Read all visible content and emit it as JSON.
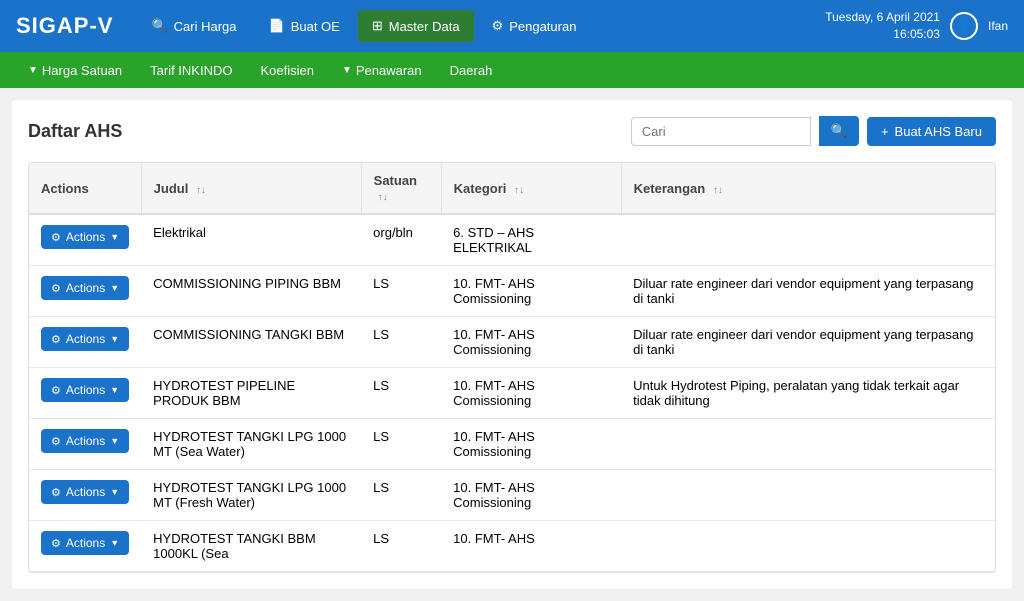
{
  "app": {
    "logo": "SIGAP-V",
    "datetime": "Tuesday, 6 April 2021",
    "time": "16:05:03",
    "user": "Ifan"
  },
  "topnav": {
    "items": [
      {
        "id": "cari-harga",
        "label": "Cari Harga",
        "icon": "🔍",
        "active": false
      },
      {
        "id": "buat-oe",
        "label": "Buat OE",
        "icon": "📄",
        "active": false
      },
      {
        "id": "master-data",
        "label": "Master Data",
        "icon": "⊞",
        "active": true
      },
      {
        "id": "pengaturan",
        "label": "Pengaturan",
        "icon": "⚙",
        "active": false
      }
    ]
  },
  "subnav": {
    "items": [
      {
        "id": "harga-satuan",
        "label": "Harga Satuan",
        "has_dropdown": true
      },
      {
        "id": "tarif-inkindo",
        "label": "Tarif INKINDO",
        "has_dropdown": false
      },
      {
        "id": "koefisien",
        "label": "Koefisien",
        "has_dropdown": false
      },
      {
        "id": "penawaran",
        "label": "Penawaran",
        "has_dropdown": true
      },
      {
        "id": "daerah",
        "label": "Daerah",
        "has_dropdown": false
      }
    ]
  },
  "page": {
    "title": "Daftar AHS",
    "search_placeholder": "Cari",
    "create_button": "Buat AHS Baru"
  },
  "table": {
    "columns": [
      {
        "id": "actions",
        "label": "Actions",
        "sortable": false
      },
      {
        "id": "judul",
        "label": "Judul",
        "sortable": true
      },
      {
        "id": "satuan",
        "label": "Satuan",
        "sortable": true
      },
      {
        "id": "kategori",
        "label": "Kategori",
        "sortable": true
      },
      {
        "id": "keterangan",
        "label": "Keterangan",
        "sortable": true
      }
    ],
    "rows": [
      {
        "id": 1,
        "judul": "Elektrikal",
        "satuan": "org/bln",
        "kategori": "6. STD – AHS ELEKTRIKAL",
        "keterangan": ""
      },
      {
        "id": 2,
        "judul": "COMMISSIONING PIPING BBM",
        "satuan": "LS",
        "kategori": "10. FMT- AHS Comissioning",
        "keterangan": "Diluar rate engineer dari vendor equipment yang terpasang di tanki"
      },
      {
        "id": 3,
        "judul": "COMMISSIONING TANGKI BBM",
        "satuan": "LS",
        "kategori": "10. FMT- AHS Comissioning",
        "keterangan": "Diluar rate engineer dari vendor equipment yang terpasang di tanki"
      },
      {
        "id": 4,
        "judul": "HYDROTEST PIPELINE PRODUK BBM",
        "satuan": "LS",
        "kategori": "10. FMT- AHS Comissioning",
        "keterangan": "Untuk Hydrotest Piping, peralatan yang tidak terkait agar tidak dihitung"
      },
      {
        "id": 5,
        "judul": "HYDROTEST TANGKI LPG 1000 MT (Sea Water)",
        "satuan": "LS",
        "kategori": "10. FMT- AHS Comissioning",
        "keterangan": ""
      },
      {
        "id": 6,
        "judul": "HYDROTEST TANGKI LPG 1000 MT (Fresh Water)",
        "satuan": "LS",
        "kategori": "10. FMT- AHS Comissioning",
        "keterangan": ""
      },
      {
        "id": 7,
        "judul": "HYDROTEST TANGKI BBM 1000KL (Sea",
        "satuan": "LS",
        "kategori": "10. FMT- AHS",
        "keterangan": ""
      }
    ],
    "actions_label": "Actions"
  }
}
